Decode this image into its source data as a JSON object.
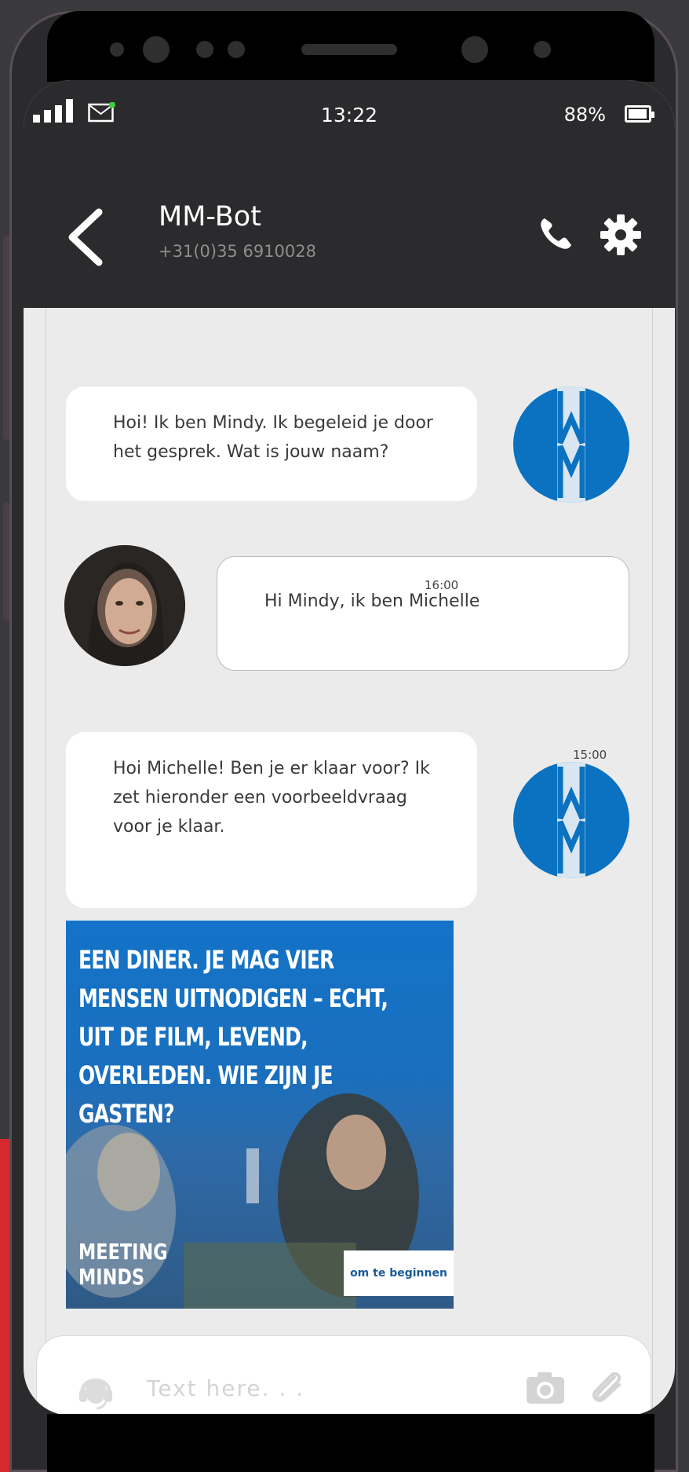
{
  "status_bar": {
    "time": "13:22",
    "battery": "88%"
  },
  "header": {
    "title": "MM-Bot",
    "phone_number": "+31(0)35 6910028"
  },
  "messages": [
    {
      "sender": "bot",
      "text": "Hoi! Ik ben Mindy. Ik begeleid je door het gesprek. Wat is jouw naam?"
    },
    {
      "sender": "user",
      "timestamp": "16:00",
      "text": "Hi Mindy, ik ben Michelle"
    },
    {
      "sender": "bot",
      "timestamp": "15:00",
      "text": "Hoi Michelle! Ben je er klaar voor? Ik zet hieronder een voorbeeldvraag voor je klaar."
    }
  ],
  "promo": {
    "question": "EEN DINER. JE MAG VIER MENSEN UITNODIGEN – ECHT, UIT DE FILM, LEVEND, OVERLEDEN. WIE ZIJN JE GASTEN?",
    "logo_line1": "MEETING",
    "logo_line2": "MINDS",
    "cta": "om te beginnen"
  },
  "input": {
    "placeholder": "Text here. . ."
  },
  "colors": {
    "header_bg": "#2b2b2d",
    "bot_blue": "#0a72c0",
    "chat_bg": "#ebebeb"
  }
}
